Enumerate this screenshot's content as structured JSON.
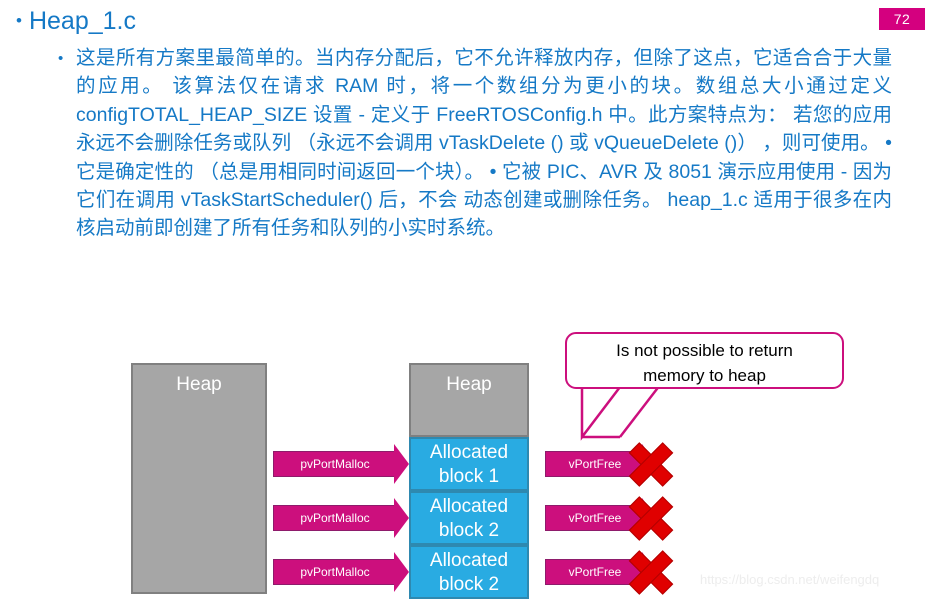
{
  "slide": {
    "title": "Heap_1.c",
    "bullet_glyph": "•",
    "page_number": "72",
    "accent_magenta": "#CC0F7D",
    "accent_blue": "#1579C6",
    "block_blue": "#29ABE2",
    "heap_gray": "#A6A6A6",
    "x_red": "#E00000"
  },
  "body": {
    "bullet_glyph": "•",
    "paragraph": "这是所有方案里最简单的。当内存分配后，它不允许释放内存，但除了这点，它适合合于大量 的应用。 该算法仅在请求 RAM 时，将一个数组分为更小的块。数组总大小通过定义 configTOTAL_HEAP_SIZE 设置 - 定义于 FreeRTOSConfig.h 中。此方案特点为： 若您的应用永远不会删除任务或队列 （永远不会调用 vTaskDelete () 或 vQueueDelete ()） ，则可使用。 • 它是确定性的 （总是用相同时间返回一个块）。 • 它被 PIC、AVR 及 8051 演示应用使用 - 因为它们在调用 vTaskStartScheduler() 后，不会 动态创建或删除任务。 heap_1.c 适用于很多在内核启动前即创建了所有任务和队列的小实时系统。"
  },
  "diagram": {
    "heap_left_label": "Heap",
    "heap_right_label": "Heap",
    "allocated_blocks": [
      {
        "line1": "Allocated",
        "line2": "block 1"
      },
      {
        "line1": "Allocated",
        "line2": "block 2"
      },
      {
        "line1": "Allocated",
        "line2": "block 2"
      }
    ],
    "malloc_arrows": [
      {
        "label": "pvPortMalloc"
      },
      {
        "label": "pvPortMalloc"
      },
      {
        "label": "pvPortMalloc"
      }
    ],
    "free_arrows": [
      {
        "label": "vPortFree"
      },
      {
        "label": "vPortFree"
      },
      {
        "label": "vPortFree"
      }
    ],
    "callout": {
      "line1": "Is not possible to return",
      "line2": "memory to heap"
    }
  },
  "watermark": {
    "text": "https://blog.csdn.net/weifengdq"
  }
}
